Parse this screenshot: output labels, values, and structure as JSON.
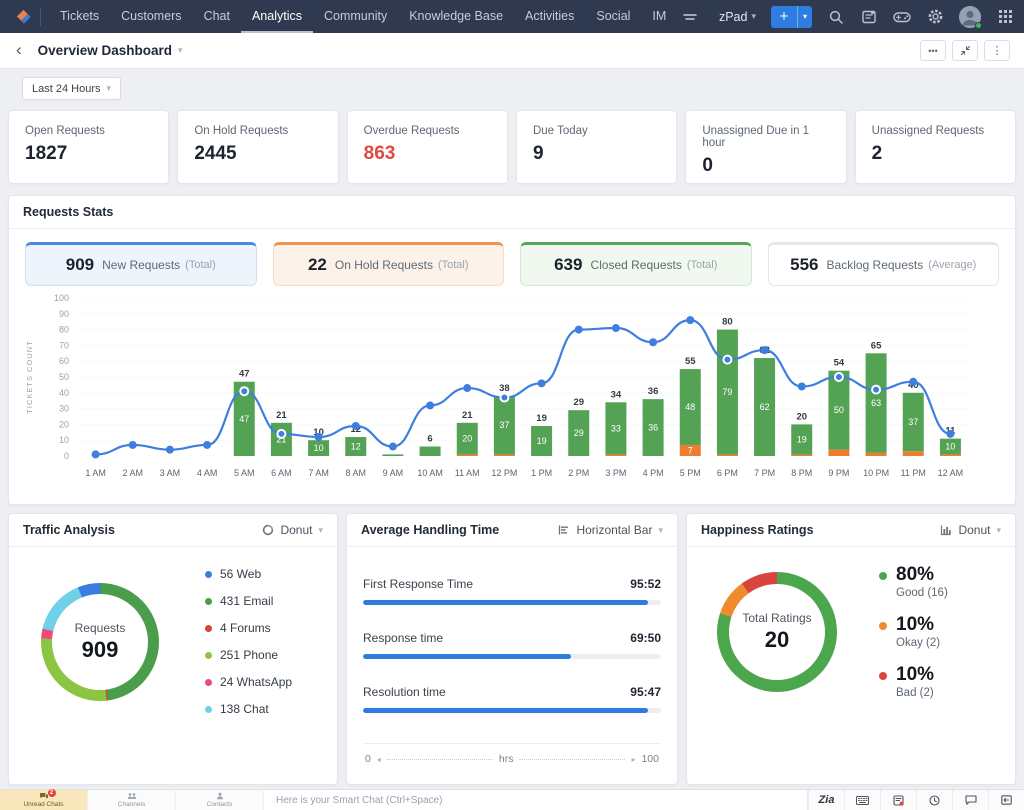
{
  "ui": {
    "caret": "▾",
    "plus": "+"
  },
  "nav": {
    "items": [
      "Tickets",
      "Customers",
      "Chat",
      "Analytics",
      "Community",
      "Knowledge Base",
      "Activities",
      "Social",
      "IM"
    ],
    "active_item": "Analytics",
    "workspace": "zPad"
  },
  "header": {
    "back_glyph": "‹",
    "title": "Overview Dashboard",
    "actions": {
      "more": "•••",
      "menu": "⋮"
    }
  },
  "filters": {
    "time_range": "Last 24 Hours"
  },
  "kpis": [
    {
      "label": "Open Requests",
      "value": "1827",
      "color": "#1d2430"
    },
    {
      "label": "On Hold Requests",
      "value": "2445",
      "color": "#1d2430"
    },
    {
      "label": "Overdue Requests",
      "value": "863",
      "color": "#e0493f"
    },
    {
      "label": "Due Today",
      "value": "9",
      "color": "#1d2430"
    },
    {
      "label": "Unassigned Due in 1 hour",
      "value": "0",
      "color": "#1d2430"
    },
    {
      "label": "Unassigned Requests",
      "value": "2",
      "color": "#1d2430"
    }
  ],
  "requests_stats": {
    "title": "Requests Stats",
    "pills": [
      {
        "value": "909",
        "label": "New Requests",
        "suffix": "(Total)",
        "accent": "#4d87e6",
        "bg": "#eef4fc",
        "border": "#cfdff5"
      },
      {
        "value": "22",
        "label": "On Hold Requests",
        "suffix": "(Total)",
        "accent": "#ef9350",
        "bg": "#fdf2ea",
        "border": "#f5dcc8"
      },
      {
        "value": "639",
        "label": "Closed Requests",
        "suffix": "(Total)",
        "accent": "#58a758",
        "bg": "#f1f8f0",
        "border": "#d5e9d4"
      },
      {
        "value": "556",
        "label": "Backlog Requests",
        "suffix": "(Average)",
        "accent": "#e3e7eb",
        "bg": "#ffffff",
        "border": "#e3e7eb"
      }
    ]
  },
  "chart_data": [
    {
      "type": "combo-bar-line",
      "title": "Requests Stats",
      "ylabel": "TICKETS COUNT",
      "ylim": [
        0,
        100
      ],
      "ytick_step": 10,
      "grid": "dotted horizontal",
      "categories": [
        "1 AM",
        "2 AM",
        "3 AM",
        "4 AM",
        "5 AM",
        "6 AM",
        "7 AM",
        "8 AM",
        "9 AM",
        "10 AM",
        "11 AM",
        "12 PM",
        "1 PM",
        "2 PM",
        "3 PM",
        "4 PM",
        "5 PM",
        "6 PM",
        "7 PM",
        "8 PM",
        "9 PM",
        "10 PM",
        "11 PM",
        "12 AM"
      ],
      "series": [
        {
          "name": "closed-bar-green",
          "type": "bar",
          "color": "#54a254",
          "values": [
            0,
            0,
            0,
            0,
            47,
            21,
            10,
            12,
            1,
            6,
            20,
            37,
            19,
            29,
            33,
            36,
            48,
            79,
            62,
            19,
            50,
            63,
            37,
            10
          ]
        },
        {
          "name": "overdue-bar-orange",
          "type": "bar",
          "color": "#ee7d2e",
          "values": [
            0,
            0,
            0,
            0,
            0,
            0,
            0,
            0,
            0,
            0,
            1,
            1,
            0,
            0,
            1,
            0,
            7,
            1,
            0,
            1,
            4,
            2,
            3,
            1
          ]
        },
        {
          "name": "new-requests-line",
          "type": "line",
          "color": "#3d7edf",
          "values": [
            1,
            7,
            4,
            7,
            41,
            14,
            12,
            19,
            6,
            32,
            43,
            37,
            46,
            80,
            81,
            72,
            86,
            61,
            67,
            44,
            50,
            42,
            47,
            14
          ]
        }
      ],
      "bar_totals": [
        null,
        null,
        null,
        null,
        47,
        21,
        10,
        12,
        1,
        6,
        21,
        38,
        19,
        29,
        34,
        36,
        55,
        80,
        62,
        20,
        54,
        65,
        40,
        11
      ]
    },
    {
      "type": "pie",
      "title": "Traffic Analysis",
      "center_label": "Requests",
      "center_value": "909",
      "start_angle": -22,
      "slices": [
        {
          "label": "Web",
          "value": 56,
          "color": "#3b7de0"
        },
        {
          "label": "Email",
          "value": 431,
          "color": "#4a9d4a"
        },
        {
          "label": "Forums",
          "value": 4,
          "color": "#d8453e"
        },
        {
          "label": "Phone",
          "value": 251,
          "color": "#8bc542"
        },
        {
          "label": "WhatsApp",
          "value": 24,
          "color": "#f0497c"
        },
        {
          "label": "Chat",
          "value": 138,
          "color": "#6fd0e8"
        }
      ]
    },
    {
      "type": "bar",
      "title": "Average Handling Time",
      "orientation": "horizontal",
      "xlim": [
        0,
        100
      ],
      "xlabel": "hrs",
      "rows": [
        {
          "label": "First Response Time",
          "value": "95:52",
          "pct": 95.8
        },
        {
          "label": "Response time",
          "value": "69:50",
          "pct": 69.8
        },
        {
          "label": "Resolution time",
          "value": "95:47",
          "pct": 95.7
        }
      ],
      "axis": {
        "min": "0",
        "mid": "hrs",
        "max": "100"
      }
    },
    {
      "type": "pie",
      "title": "Happiness Ratings",
      "center_label": "Total Ratings",
      "center_value": "20",
      "start_angle": 0,
      "slices": [
        {
          "label": "Good",
          "value": 16,
          "pct": "80%",
          "sub": "Good (16)",
          "color": "#4ca64c"
        },
        {
          "label": "Okay",
          "value": 2,
          "pct": "10%",
          "sub": "Okay (2)",
          "color": "#ef8b2e"
        },
        {
          "label": "Bad",
          "value": 2,
          "pct": "10%",
          "sub": "Bad (2)",
          "color": "#d8453e"
        }
      ]
    }
  ],
  "panels": {
    "traffic": {
      "title": "Traffic Analysis",
      "view": "Donut"
    },
    "handling": {
      "title": "Average Handling Time",
      "view": "Horizontal Bar"
    },
    "happiness": {
      "title": "Happiness Ratings",
      "view": "Donut"
    }
  },
  "chat_bar": {
    "tabs": [
      {
        "label": "Unread Chats",
        "badge": "2",
        "icon": "chats-icon",
        "active": true
      },
      {
        "label": "Channels",
        "icon": "channels-icon",
        "active": false
      },
      {
        "label": "Contacts",
        "icon": "contacts-icon",
        "active": false
      }
    ],
    "input_placeholder": "Here is your Smart Chat (Ctrl+Space)",
    "zia_label": "Zia"
  }
}
